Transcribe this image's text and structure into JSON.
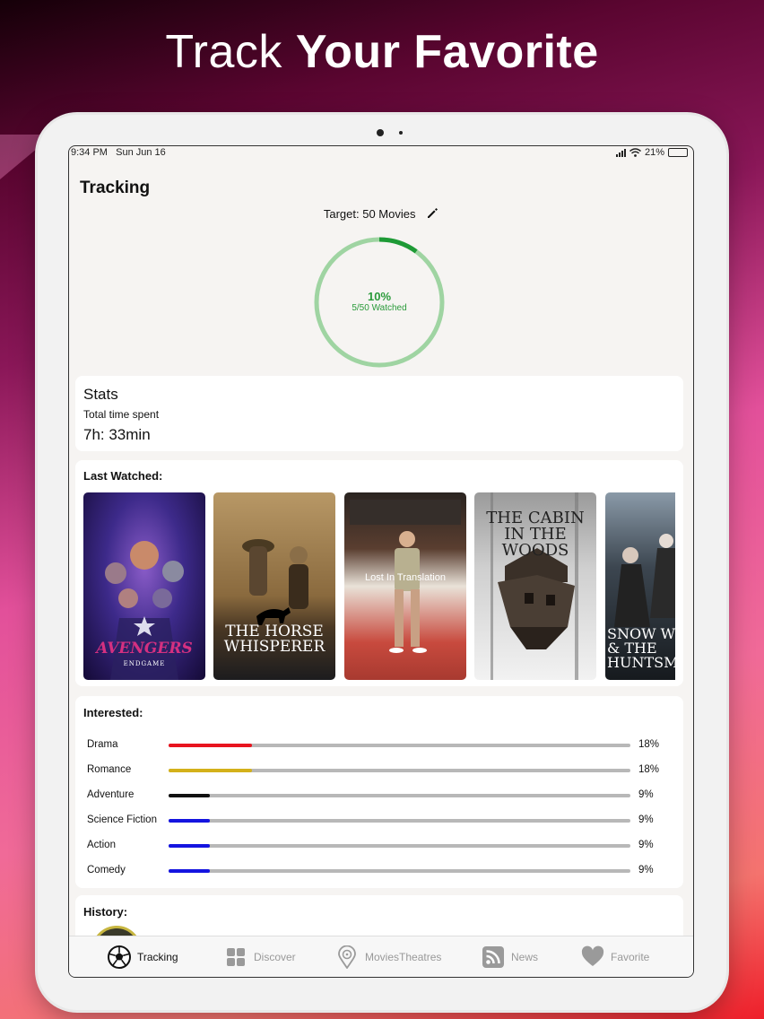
{
  "headline": {
    "light": "Track",
    "bold": "Your Favorite"
  },
  "status": {
    "time": "9:34 PM",
    "date": "Sun Jun 16",
    "battery": "21%"
  },
  "page_title": "Tracking",
  "target": {
    "label": "Target: 50 Movies"
  },
  "progress": {
    "percent_label": "10%",
    "watched_label": "5/50 Watched",
    "fraction": 0.1
  },
  "stats": {
    "title": "Stats",
    "time_label": "Total time spent",
    "time_value": "7h: 33min"
  },
  "last_watched": {
    "title": "Last Watched:",
    "posters": [
      {
        "title": "AVENGERS",
        "subtitle": "ENDGAME",
        "icon": "avengers-poster"
      },
      {
        "title": "THE HORSE WHISPERER",
        "icon": "horse-whisperer-poster"
      },
      {
        "title": "Lost In Translation",
        "icon": "lost-in-translation-poster"
      },
      {
        "title": "THE CABIN IN THE WOODS",
        "icon": "cabin-in-the-woods-poster"
      },
      {
        "title": "SNOW WHITE & THE HUNTSMAN",
        "icon": "snow-white-poster"
      }
    ]
  },
  "interested": {
    "title": "Interested:",
    "genres": [
      {
        "name": "Drama",
        "pct": "18%",
        "value": 0.18,
        "color": "#e8141e"
      },
      {
        "name": "Romance",
        "pct": "18%",
        "value": 0.18,
        "color": "#d4b11a"
      },
      {
        "name": "Adventure",
        "pct": "9%",
        "value": 0.09,
        "color": "#111111"
      },
      {
        "name": "Science Fiction",
        "pct": "9%",
        "value": 0.09,
        "color": "#1414e0"
      },
      {
        "name": "Action",
        "pct": "9%",
        "value": 0.09,
        "color": "#1414e0"
      },
      {
        "name": "Comedy",
        "pct": "9%",
        "value": 0.09,
        "color": "#1414e0"
      }
    ]
  },
  "history": {
    "title": "History:"
  },
  "tabs": [
    {
      "label": "Tracking",
      "icon": "soccer-ball-icon",
      "active": true
    },
    {
      "label": "Discover",
      "icon": "grid-icon",
      "active": false
    },
    {
      "label": "MoviesTheatres",
      "icon": "map-pin-icon",
      "active": false
    },
    {
      "label": "News",
      "icon": "rss-icon",
      "active": false
    },
    {
      "label": "Favorite",
      "icon": "heart-icon",
      "active": false
    }
  ],
  "colors": {
    "ring_done": "#1e9a36",
    "ring_remaining": "#9fd4a2",
    "accent_text": "#2a9a3a"
  }
}
